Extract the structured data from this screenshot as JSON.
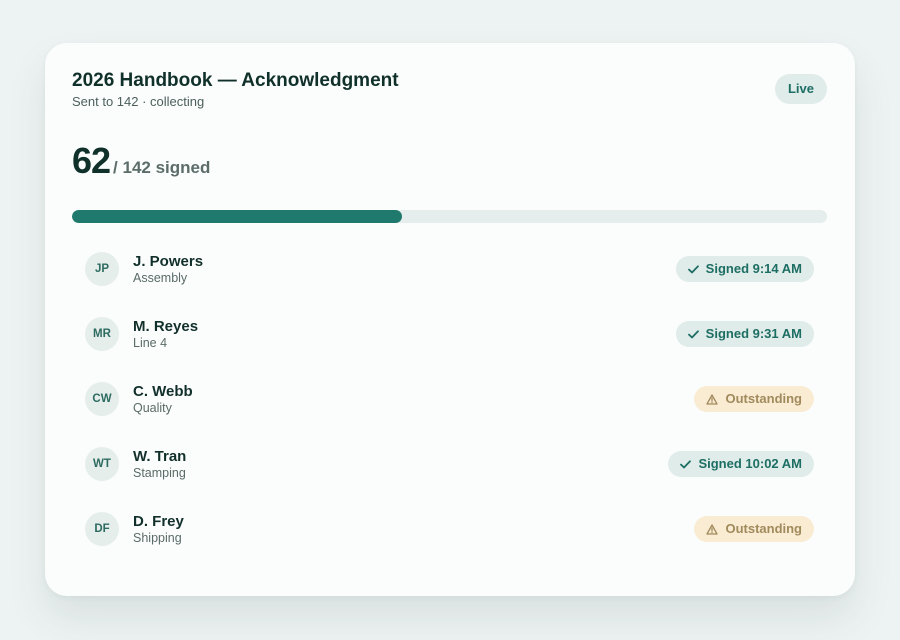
{
  "header": {
    "title": "2026 Handbook — Acknowledgment",
    "subtitle": "Sent to 142 · collecting",
    "badge": "Live"
  },
  "summary": {
    "signed_count": "62",
    "total_text": "/ 142 signed",
    "progress_fraction": 0.4366
  },
  "colors": {
    "accent": "#1f7a6d",
    "signed_bg": "#e0ecea",
    "outstanding_bg": "#f9ecd3"
  },
  "recipients": [
    {
      "initials": "JP",
      "name": "J. Powers",
      "dept": "Assembly",
      "status": "Signed 9:14 AM",
      "state": "signed",
      "icon": "check-icon"
    },
    {
      "initials": "MR",
      "name": "M. Reyes",
      "dept": "Line 4",
      "status": "Signed 9:31 AM",
      "state": "signed",
      "icon": "check-icon"
    },
    {
      "initials": "CW",
      "name": "C. Webb",
      "dept": "Quality",
      "status": "Outstanding",
      "state": "outstanding",
      "icon": "warning-icon"
    },
    {
      "initials": "WT",
      "name": "W. Tran",
      "dept": "Stamping",
      "status": "Signed 10:02 AM",
      "state": "signed",
      "icon": "check-icon"
    },
    {
      "initials": "DF",
      "name": "D. Frey",
      "dept": "Shipping",
      "status": "Outstanding",
      "state": "outstanding",
      "icon": "warning-icon"
    }
  ]
}
